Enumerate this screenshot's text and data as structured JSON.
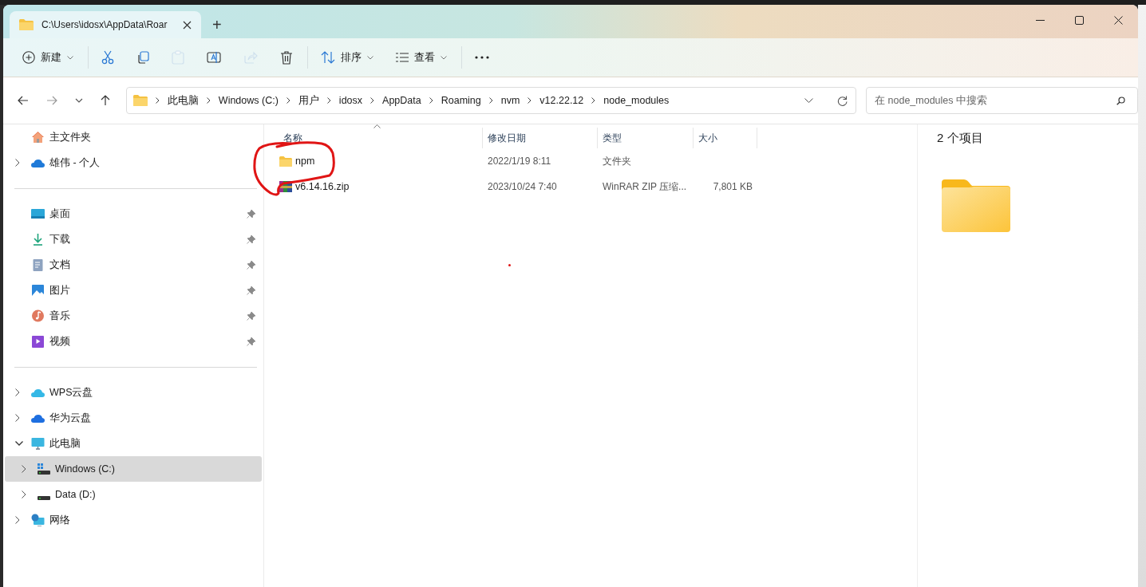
{
  "window": {
    "tab_title": "C:\\Users\\idosx\\AppData\\Roar",
    "new_tab": "+"
  },
  "toolbar": {
    "buttons": [
      {
        "label": "新建",
        "dropdown": true,
        "disabled": false
      },
      {
        "disabled": false
      },
      {
        "disabled": false
      },
      {
        "disabled": true
      },
      {
        "disabled": false
      },
      {
        "disabled": true
      },
      {
        "disabled": false
      },
      {
        "label": "排序",
        "dropdown": true,
        "disabled": false
      },
      {
        "label": "查看",
        "dropdown": true,
        "disabled": false
      },
      {
        "disabled": false
      }
    ]
  },
  "address": {
    "crumbs": [
      "此电脑",
      "Windows (C:)",
      "用户",
      "idosx",
      "AppData",
      "Roaming",
      "nvm",
      "v12.22.12",
      "node_modules"
    ],
    "search_placeholder": "在 node_modules 中搜索"
  },
  "sidebar": {
    "sections": [
      [
        {
          "label": "主文件夹",
          "selected": false
        },
        {
          "label": "雄伟 - 个人",
          "selected": false,
          "expanded": false
        }
      ],
      [
        {
          "label": "桌面",
          "selected": false,
          "pinned": true
        },
        {
          "label": "下载",
          "selected": false,
          "pinned": true
        },
        {
          "label": "文档",
          "selected": false,
          "pinned": true
        },
        {
          "label": "图片",
          "selected": false,
          "pinned": true
        },
        {
          "label": "音乐",
          "selected": false,
          "pinned": true
        },
        {
          "label": "视频",
          "selected": false,
          "pinned": true
        }
      ],
      [
        {
          "label": "WPS云盘",
          "selected": false,
          "expanded": false
        },
        {
          "label": "华为云盘",
          "selected": false,
          "expanded": false
        },
        {
          "label": "此电脑",
          "selected": false,
          "expanded": true,
          "children": [
            {
              "label": "Windows (C:)",
              "selected": true,
              "expanded": false
            },
            {
              "label": "Data (D:)",
              "selected": false,
              "expanded": false
            }
          ]
        },
        {
          "label": "网络",
          "selected": false,
          "expanded": false
        }
      ]
    ]
  },
  "files": {
    "columns": [
      {
        "label": "名称",
        "sorted": true
      },
      {
        "label": "修改日期",
        "sorted": false
      },
      {
        "label": "类型",
        "sorted": false
      },
      {
        "label": "大小",
        "sorted": false
      }
    ],
    "rows": [
      {
        "kind": "folder",
        "name": "npm",
        "modified": "2022/1/19 8:11",
        "type": "文件夹"
      },
      {
        "kind": "archive",
        "name": "v6.14.16.zip",
        "modified": "2023/10/24 7:40",
        "type": "WinRAR ZIP 压缩...",
        "size": "7,801 KB"
      }
    ]
  },
  "details": {
    "count": "2 个项目"
  }
}
